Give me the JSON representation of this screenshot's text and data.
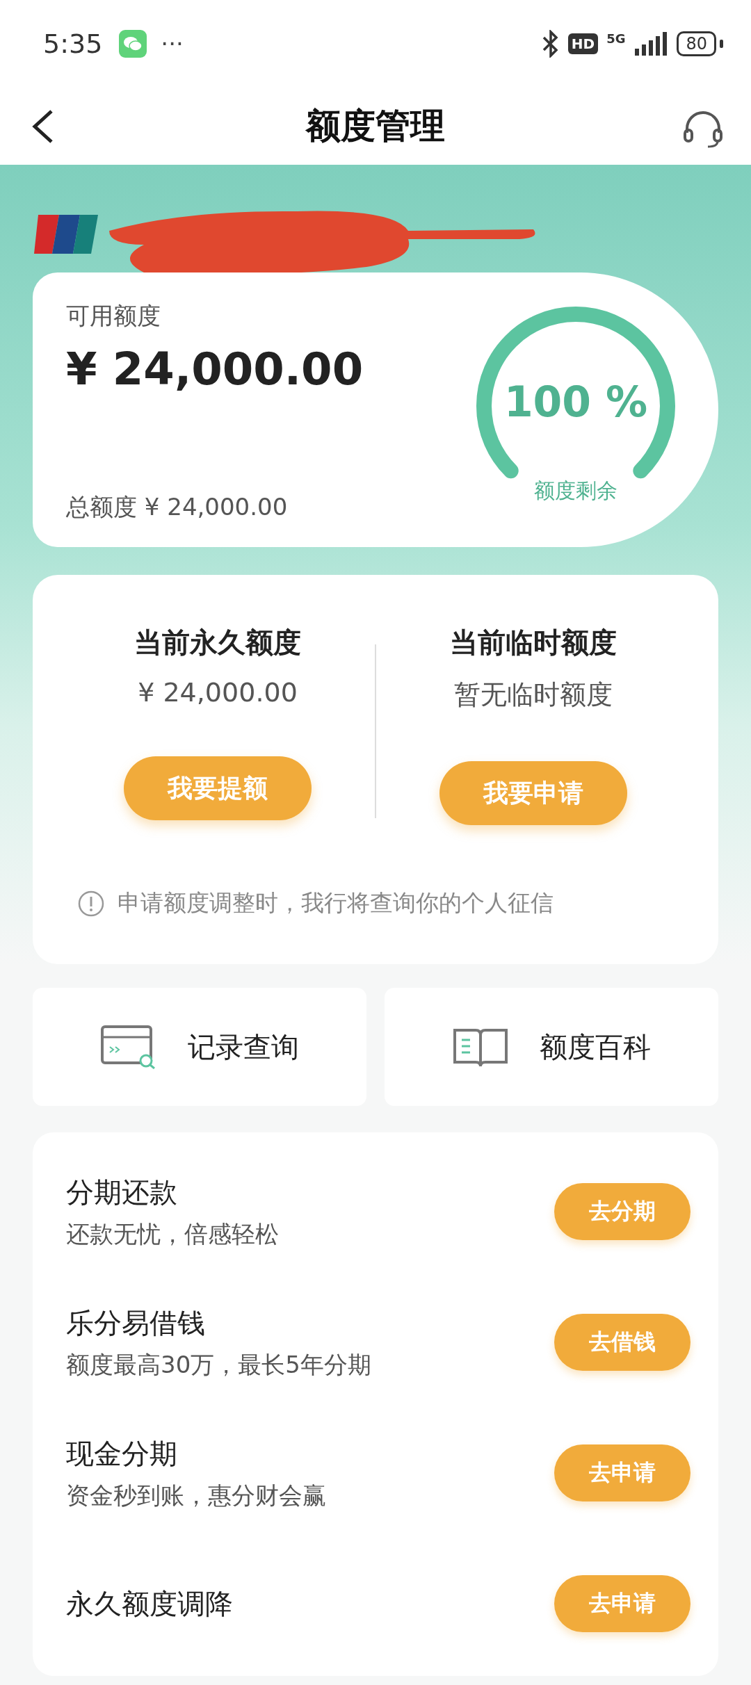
{
  "status_bar": {
    "time": "5:35",
    "more": "···",
    "network_badge": "HD",
    "network": "5G",
    "battery": "80"
  },
  "header": {
    "title": "额度管理"
  },
  "summary": {
    "label": "可用额度",
    "amount": "¥ 24,000.00",
    "total": "总额度 ¥ 24,000.00",
    "gauge": {
      "level": 1.0,
      "value": "100 %",
      "caption": "额度剩余"
    }
  },
  "quota": {
    "columns": [
      {
        "title": "当前永久额度",
        "value": "¥ 24,000.00",
        "button": "我要提额"
      },
      {
        "title": "当前临时额度",
        "value": "暂无临时额度",
        "button": "我要申请"
      }
    ],
    "notice": "申请额度调整时，我行将查询你的个人征信"
  },
  "shortcuts": [
    {
      "kind": "records",
      "label": "记录查询"
    },
    {
      "kind": "guide",
      "label": "额度百科"
    }
  ],
  "services": [
    {
      "title": "分期还款",
      "subtitle": "还款无忧，倍感轻松",
      "button": "去分期"
    },
    {
      "title": "乐分易借钱",
      "subtitle": "额度最高30万，最长5年分期",
      "button": "去借钱"
    },
    {
      "title": "现金分期",
      "subtitle": "资金秒到账，惠分财会赢",
      "button": "去申请"
    },
    {
      "title": "永久额度调降",
      "button": "去申请"
    }
  ]
}
